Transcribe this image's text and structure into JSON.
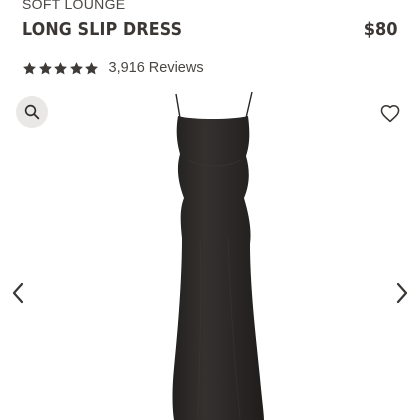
{
  "product": {
    "collection": "SOFT LOUNGE",
    "name": "LONG SLIP DRESS",
    "price": "$80"
  },
  "rating": {
    "stars": 5,
    "count": "3,916",
    "label": "Reviews"
  },
  "icons": {
    "star": "star-icon",
    "zoom": "magnifier-icon",
    "favorite": "heart-outline-icon",
    "previous": "chevron-left-icon",
    "next": "chevron-right-icon"
  },
  "colors": {
    "text": "#3b3735",
    "zoom_button_bg": "#eae8e6",
    "dress": "#2c2a29"
  }
}
